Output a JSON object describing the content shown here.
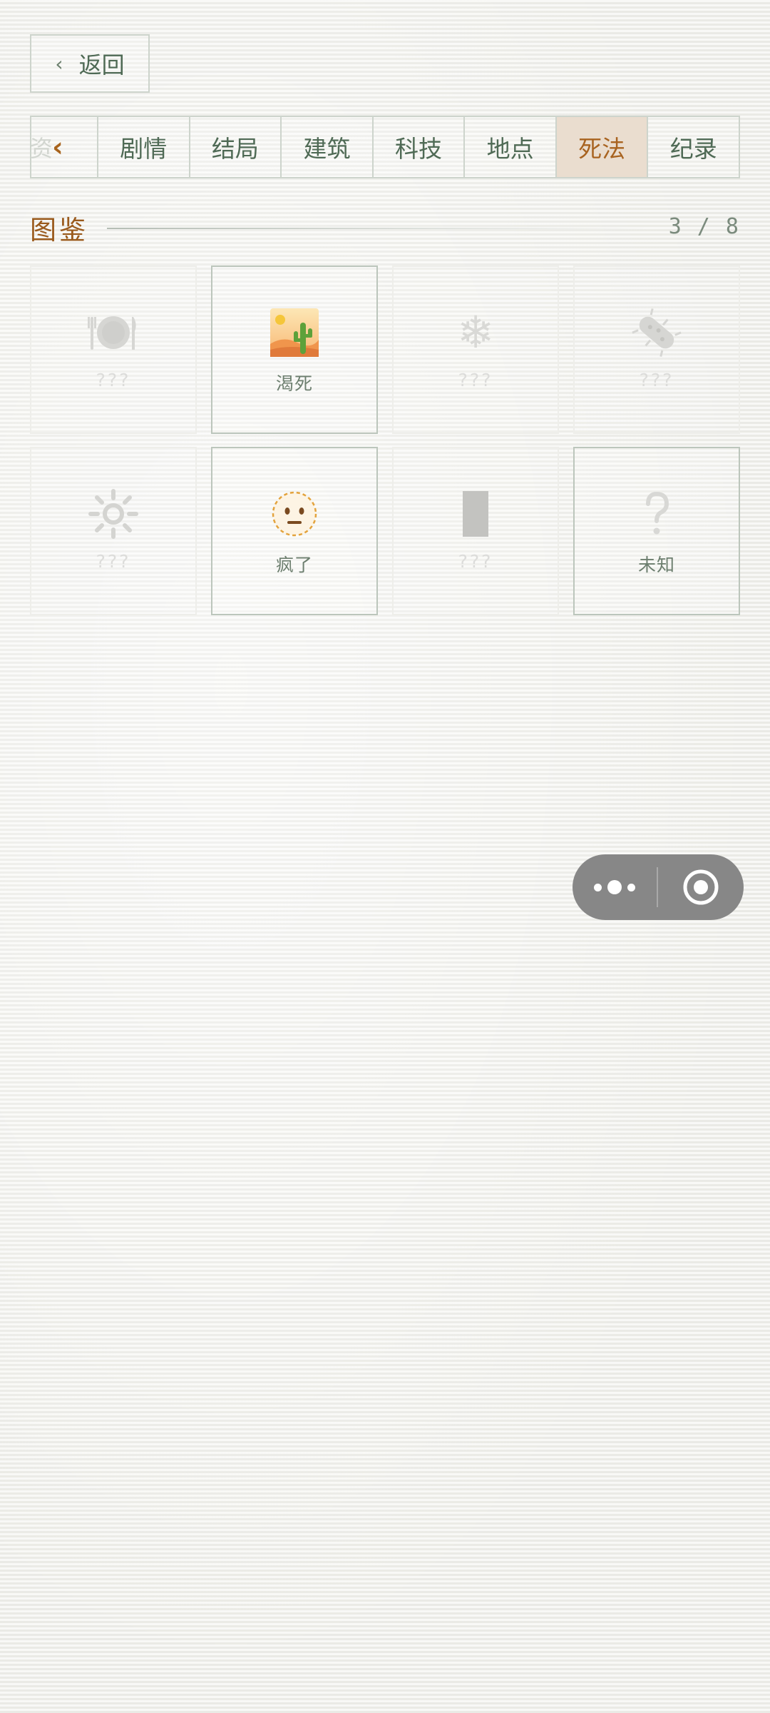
{
  "back_button": {
    "chevron": "‹",
    "label": "返回"
  },
  "tabs": {
    "prev_ghost": "资",
    "prev_arrow": "‹",
    "items": [
      {
        "label": "剧情",
        "active": false
      },
      {
        "label": "结局",
        "active": false
      },
      {
        "label": "建筑",
        "active": false
      },
      {
        "label": "科技",
        "active": false
      },
      {
        "label": "地点",
        "active": false
      },
      {
        "label": "死法",
        "active": true
      },
      {
        "label": "纪录",
        "active": false
      }
    ]
  },
  "section": {
    "title": "图鉴",
    "count": "3 / 8"
  },
  "cards": [
    {
      "icon": "plate-cutlery-icon",
      "glyph": "🍽",
      "label": "???",
      "unlocked": false
    },
    {
      "icon": "desert-cactus-icon",
      "glyph": "",
      "label": "渴死",
      "unlocked": true
    },
    {
      "icon": "snowflake-icon",
      "glyph": "❄",
      "label": "???",
      "unlocked": false
    },
    {
      "icon": "microbe-icon",
      "glyph": "",
      "label": "???",
      "unlocked": false
    },
    {
      "icon": "sun-icon",
      "glyph": "",
      "label": "???",
      "unlocked": false
    },
    {
      "icon": "dotted-face-icon",
      "glyph": "",
      "label": "疯了",
      "unlocked": true
    },
    {
      "icon": "dark-block-icon",
      "glyph": "",
      "label": "???",
      "unlocked": false
    },
    {
      "icon": "question-mark-icon",
      "glyph": "?",
      "label": "未知",
      "unlocked": true
    }
  ],
  "capsule": {
    "more_icon": "more-dots-icon",
    "close_icon": "target-close-icon"
  }
}
